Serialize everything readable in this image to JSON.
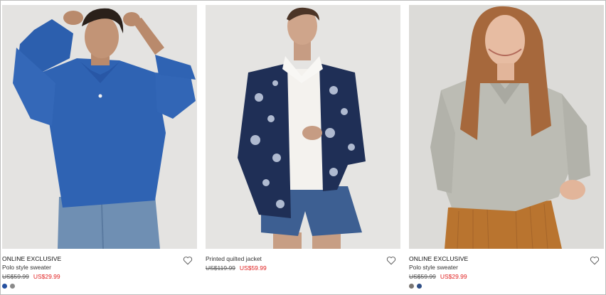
{
  "products": [
    {
      "badge": "ONLINE EXCLUSIVE",
      "name": "Polo style sweater",
      "old_price": "US$59.99",
      "new_price": "US$29.99",
      "swatches": [
        "#2550a0",
        "#8a8a8a"
      ],
      "icon": "heart-icon"
    },
    {
      "badge": "",
      "name": "Printed quilted jacket",
      "old_price": "US$119.99",
      "new_price": "US$59.99",
      "swatches": [],
      "icon": "heart-icon"
    },
    {
      "badge": "ONLINE EXCLUSIVE",
      "name": "Polo style sweater",
      "old_price": "US$59.99",
      "new_price": "US$29.99",
      "swatches": [
        "#7a7672",
        "#2f4f86"
      ],
      "icon": "heart-icon"
    }
  ],
  "colors": {
    "sale_price": "#e01f1f",
    "border": "#bdbdbd"
  }
}
